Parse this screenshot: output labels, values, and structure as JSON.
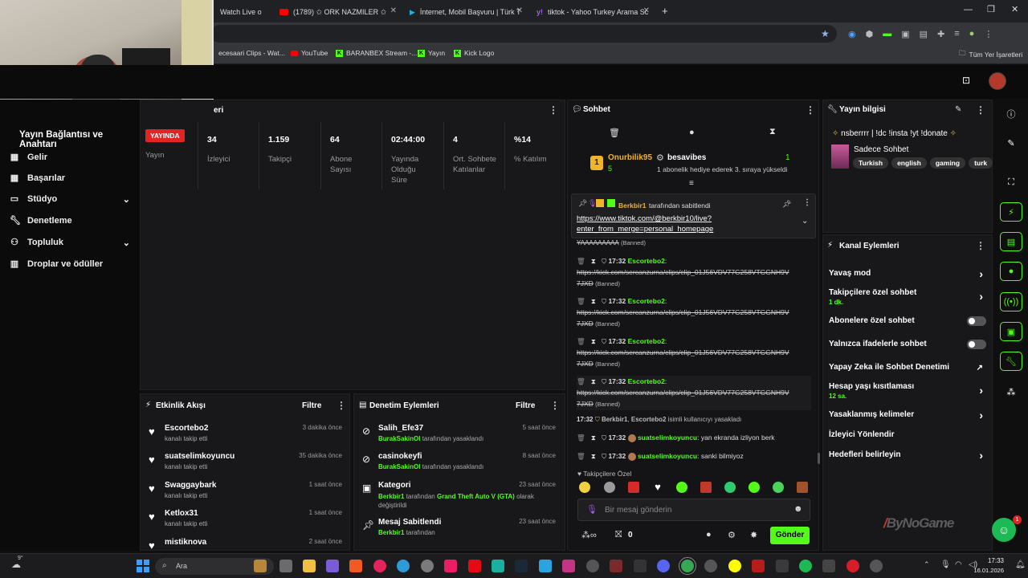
{
  "browser": {
    "tabs": [
      {
        "label": "Watch Live o",
        "icon": "kick-icon"
      },
      {
        "label": "(1789) ✩ ORK NAZMILER ✩",
        "icon": "youtube-icon"
      },
      {
        "label": "İnternet, Mobil Başvuru | Türk T",
        "icon": "turk-telekom-icon"
      },
      {
        "label": "tiktok - Yahoo Turkey Arama Sc",
        "icon": "yahoo-icon"
      }
    ],
    "new_tab": "+",
    "bookmarks": [
      "ecesaari Clips - Wat...",
      "YouTube",
      "BARANBEX Stream -...",
      "Yayın",
      "Kick Logo"
    ],
    "all_bookmarks": "Tüm Yer İşaretleri"
  },
  "sidebar": {
    "title": "Yayın Bağlantısı ve Anahtarı",
    "items": [
      "Gelir",
      "Başarılar",
      "Stüdyo",
      "Denetleme",
      "Topluluk",
      "Droplar ve ödüller"
    ]
  },
  "stats": {
    "header_suffix": "eri",
    "live_badge": "YAYINDA",
    "live_label": "Yayın",
    "items": [
      {
        "value": "34",
        "label": "İzleyici"
      },
      {
        "value": "1.159",
        "label": "Takipçi"
      },
      {
        "value": "64",
        "label": "Abone Sayısı"
      },
      {
        "value": "02:44:00",
        "label": "Yayında Olduğu Süre"
      },
      {
        "value": "4",
        "label": "Ort. Sohbete Katılanlar"
      },
      {
        "value": "%14",
        "label": "% Katılım"
      }
    ]
  },
  "activity": {
    "title": "Etkinlik Akışı",
    "filter": "Filtre",
    "items": [
      {
        "name": "Escortebo2",
        "sub": "kanalı takip etti",
        "time": "3 dakika önce"
      },
      {
        "name": "suatselimkoyuncu",
        "sub": "kanalı takip etti",
        "time": "35 dakika önce"
      },
      {
        "name": "Swaggaybark",
        "sub": "kanalı takip etti",
        "time": "1 saat önce"
      },
      {
        "name": "Ketlox31",
        "sub": "kanalı takip etti",
        "time": "1 saat önce"
      },
      {
        "name": "mistiknova",
        "sub": "",
        "time": "2 saat önce"
      }
    ]
  },
  "moderation": {
    "title": "Denetim Eylemleri",
    "filter": "Filtre",
    "items": [
      {
        "name": "Salih_Efe37",
        "actor": "BurakSakinOl",
        "action": "tarafından yasaklandı",
        "time": "5 saat önce"
      },
      {
        "name": "casinokeyfi",
        "actor": "BurakSakinOl",
        "action": "tarafından yasaklandı",
        "time": "8 saat önce"
      },
      {
        "name": "Kategori",
        "actor": "Berkbir1",
        "action": "tarafından",
        "extra": "Grand Theft Auto V (GTA)",
        "extra2": "olarak değiştirildi",
        "time": "23 saat önce"
      },
      {
        "name": "Mesaj Sabitlendi",
        "actor": "Berkbir1",
        "action": "tarafından",
        "time": "23 saat önce"
      }
    ]
  },
  "chat": {
    "title": "Sohbet",
    "gift": {
      "user": "Onurbilik95",
      "count": "5",
      "rank": "1",
      "gifter": "besavibes",
      "gift_count": "1",
      "gift_text": "1 abonelik hediye ederek 3. sıraya yükseldi"
    },
    "pinned": {
      "by": "Berkbir1",
      "by_suffix": "tarafından sabitlendi",
      "link": "https://www.tiktok.com/@berkbir10/live?enter_from_merge=personal_homepage",
      "link_line1": "https://www.tiktok.com/@berkbir10/live?",
      "link_line2": "enter_from_merge=personal_homepage"
    },
    "partial": "YAAAAAAAAA",
    "banned": "(Banned)",
    "messages": [
      {
        "time": "17:32",
        "user": "Escortebo2",
        "l1": "https://kick.com/sercanzurna/clips/clip_01J56VDV77G258VTGGNH9V",
        "l2": "7JXD"
      },
      {
        "time": "17:32",
        "user": "Escortebo2",
        "l1": "https://kick.com/sercanzurna/clips/clip_01J56VDV77G258VTGGNH9V",
        "l2": "7JXD"
      },
      {
        "time": "17:32",
        "user": "Escortebo2",
        "l1": "https://kick.com/sercanzurna/clips/clip_01J56VDV77G258VTGGNH9V",
        "l2": "7JXD"
      },
      {
        "time": "17:32",
        "user": "Escortebo2",
        "l1": "https://kick.com/sercanzurna/clips/clip_01J56VDV77G258VTGGNH9V",
        "l2": "7JXD"
      }
    ],
    "system": {
      "time": "17:32",
      "actor": "Berkbir1",
      "target": "Escortebo2",
      "text": "isimli kullanıcıyı yasakladı"
    },
    "msg_a": {
      "time": "17:32",
      "user": "suatselimkoyuncu",
      "text": "yan ekranda izliyon berk"
    },
    "msg_b": {
      "time": "17:32",
      "user": "suatselimkoyuncu",
      "text": "sanki bilmiyoz"
    },
    "followers_only": "Takipçilere Özel",
    "input_placeholder": "Bir mesaj gönderin",
    "points": "0",
    "send": "Gönder"
  },
  "info": {
    "title": "Yayın bilgisi",
    "stream_title": "nsberrrr | !dc !insta !yt !donate",
    "category": "Sadece Sohbet",
    "tags": [
      "Turkish",
      "english",
      "gaming",
      "turk"
    ]
  },
  "channel_actions": {
    "title": "Kanal Eylemleri",
    "rows": [
      {
        "label": "Yavaş mod",
        "sub": "",
        "control": "chevron"
      },
      {
        "label": "Takipçilere özel sohbet",
        "sub": "1 dk.",
        "control": "chevron"
      },
      {
        "label": "Abonelere özel sohbet",
        "sub": "",
        "control": "toggle"
      },
      {
        "label": "Yalnızca ifadelerle sohbet",
        "sub": "",
        "control": "toggle"
      },
      {
        "label": "Yapay Zeka ile Sohbet Denetimi",
        "sub": "",
        "control": "external"
      },
      {
        "label": "Hesap yaşı kısıtlaması",
        "sub": "12 sa.",
        "control": "chevron"
      },
      {
        "label": "Yasaklanmış kelimeler",
        "sub": "",
        "control": "chevron"
      },
      {
        "label": "İzleyici Yönlendir",
        "sub": "",
        "control": "none"
      },
      {
        "label": "Hedefleri belirleyin",
        "sub": "",
        "control": "chevron"
      }
    ]
  },
  "watermark": "ByNoGame",
  "notification_count": "1",
  "taskbar": {
    "search": "Ara",
    "time": "17:33",
    "date": "16.01.2026",
    "temp": "9°"
  },
  "colors": {
    "kick_green": "#53fc18",
    "live_red": "#e32424",
    "bg": "#0f0f10",
    "panel": "#18181a"
  }
}
